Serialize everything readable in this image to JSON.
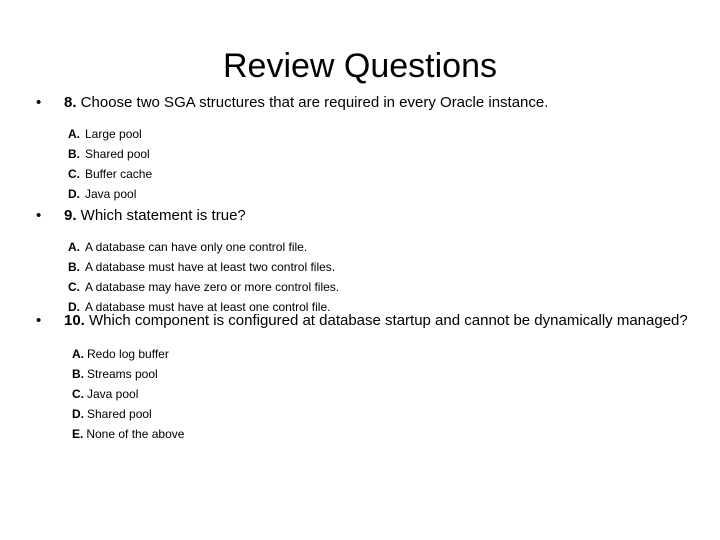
{
  "slide": {
    "title": "Review Questions",
    "bullet_glyph": "•",
    "questions": [
      {
        "number": "8.",
        "text": " Choose two SGA structures that are required in every Oracle instance.",
        "choices": [
          {
            "letter": "A.",
            "text": "Large pool"
          },
          {
            "letter": "B.",
            "text": "Shared pool"
          },
          {
            "letter": "C.",
            "text": "Buffer cache"
          },
          {
            "letter": "D.",
            "text": "Java pool"
          }
        ]
      },
      {
        "number": "9.",
        "text": " Which statement is true?",
        "choices": [
          {
            "letter": "A.",
            "text": "A database can have only one control file."
          },
          {
            "letter": "B.",
            "text": "A database must have at least two control files."
          },
          {
            "letter": "C.",
            "text": "A database may have zero or more control files."
          },
          {
            "letter": "D.",
            "text": "A database must have at least one control file."
          }
        ]
      },
      {
        "number": "10.",
        "text": " Which component is configured at database startup and cannot be dynamically managed?",
        "choices": [
          {
            "letter": "A.",
            "text": "Redo log buffer"
          },
          {
            "letter": "B.",
            "text": "Streams pool"
          },
          {
            "letter": "C.",
            "text": "Java pool"
          },
          {
            "letter": "D.",
            "text": "Shared pool"
          },
          {
            "letter": "E.",
            "text": "None of the above"
          }
        ]
      }
    ]
  }
}
